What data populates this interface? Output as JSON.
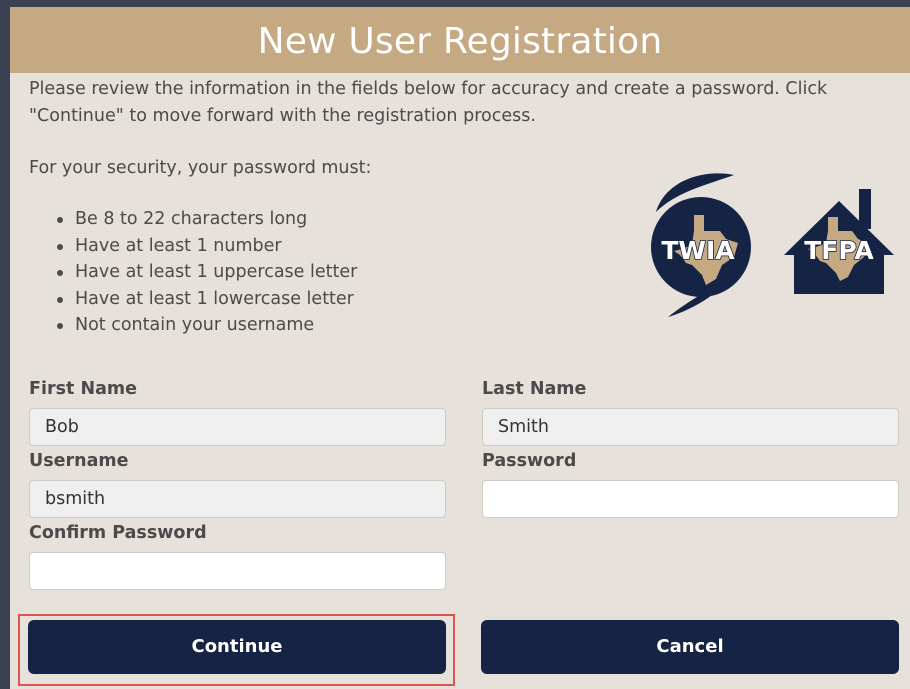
{
  "page": {
    "title": "New User Registration",
    "intro": "Please review the information in the fields below for accuracy and create a password. Click \"Continue\" to move forward with the registration process.",
    "security_title": "For your security, your password must:",
    "requirements": [
      "Be 8 to 22 characters long",
      "Have at least 1 number",
      "Have at least 1 uppercase letter",
      "Have at least 1 lowercase letter",
      "Not contain your username"
    ]
  },
  "logos": {
    "twia_text": "TWIA",
    "tfpa_text": "TFPA",
    "navy": "#152444",
    "tan": "#c4a983"
  },
  "form": {
    "first_name": {
      "label": "First Name",
      "value": "Bob"
    },
    "last_name": {
      "label": "Last Name",
      "value": "Smith"
    },
    "username": {
      "label": "Username",
      "value": "bsmith"
    },
    "password": {
      "label": "Password",
      "value": ""
    },
    "confirm_password": {
      "label": "Confirm Password",
      "value": ""
    }
  },
  "buttons": {
    "continue_label": "Continue",
    "cancel_label": "Cancel"
  },
  "colors": {
    "header_bg": "#c4a983",
    "panel_bg": "#e6e1da",
    "button_bg": "#152444",
    "highlight_border": "#e0544d"
  }
}
